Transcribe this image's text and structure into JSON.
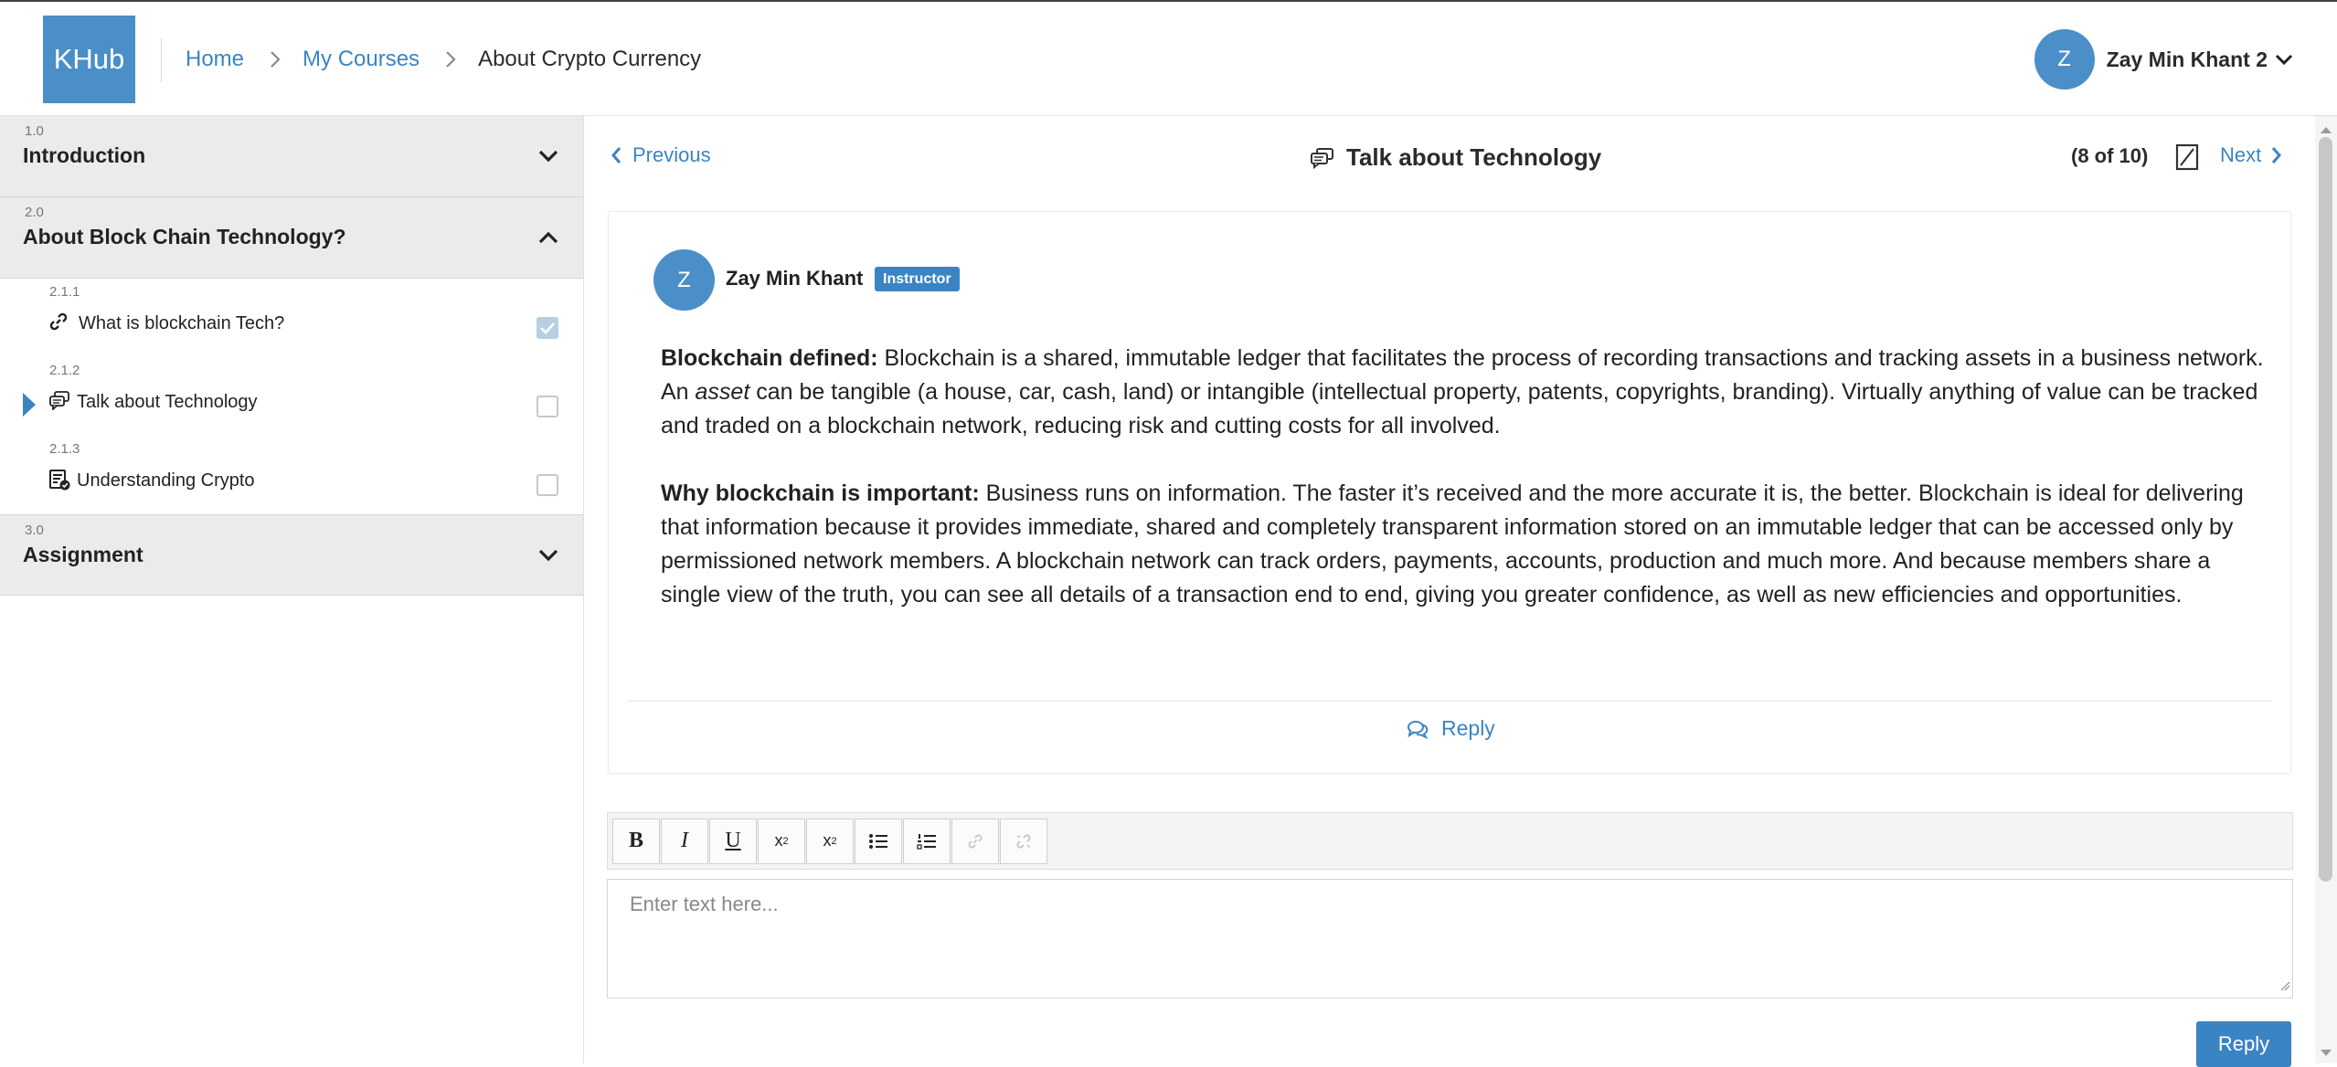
{
  "header": {
    "logo": "KHub",
    "breadcrumbs": [
      "Home",
      "My Courses",
      "About Crypto Currency"
    ],
    "user_initial": "Z",
    "user_name": "Zay Min Khant 2"
  },
  "sidebar": {
    "sections": [
      {
        "number": "1.0",
        "title": "Introduction",
        "expanded": false
      },
      {
        "number": "2.0",
        "title": "About Block Chain Technology?",
        "expanded": true,
        "lessons": [
          {
            "number": "2.1.1",
            "title": "What is blockchain Tech?",
            "icon": "link-icon",
            "completed": true
          },
          {
            "number": "2.1.2",
            "title": "Talk about Technology",
            "icon": "discussion-icon",
            "completed": false,
            "active": true
          },
          {
            "number": "2.1.3",
            "title": "Understanding Crypto",
            "icon": "quiz-icon",
            "completed": false
          }
        ]
      },
      {
        "number": "3.0",
        "title": "Assignment",
        "expanded": false
      }
    ]
  },
  "main": {
    "prev_label": "Previous",
    "next_label": "Next",
    "topic_title": "Talk about Technology",
    "progress": "(8 of 10)",
    "post": {
      "author_initial": "Z",
      "author": "Zay Min Khant",
      "badge": "Instructor",
      "p1_bold": "Blockchain defined:",
      "p1_a": " Blockchain is a shared, immutable ledger that facilitates the process of recording transactions and tracking assets in a business network. An ",
      "p1_em": "asset",
      "p1_b": " can be tangible (a house, car, cash, land) or intangible (intellectual property, patents, copyrights, branding). Virtually anything of value can be tracked and traded on a blockchain network, reducing risk and cutting costs for all involved.",
      "p2_bold": "Why blockchain is important:",
      "p2_a": " Business runs on information. The faster it’s received and the more accurate it is, the better. Blockchain is ideal for delivering that information because it provides immediate, shared and completely transparent information stored on an immutable ledger that can be accessed only by permissioned network members. A blockchain network can track orders, payments, accounts, production and much more. And because members share a single view of the truth, you can see all details of a transaction end to end, giving you greater confidence, as well as new efficiencies and opportunities.",
      "reply_label": "Reply"
    },
    "toolbar": {
      "bold": "B",
      "italic": "I",
      "underline": "U",
      "subscript": "x",
      "subscript_mark": "2",
      "superscript": "x",
      "superscript_mark": "2"
    },
    "editor_placeholder": "Enter text here...",
    "submit_label": "Reply"
  },
  "colors": {
    "accent": "#3a84c4",
    "logo_bg": "#4a8fc8",
    "section_bg": "#ebebeb"
  }
}
